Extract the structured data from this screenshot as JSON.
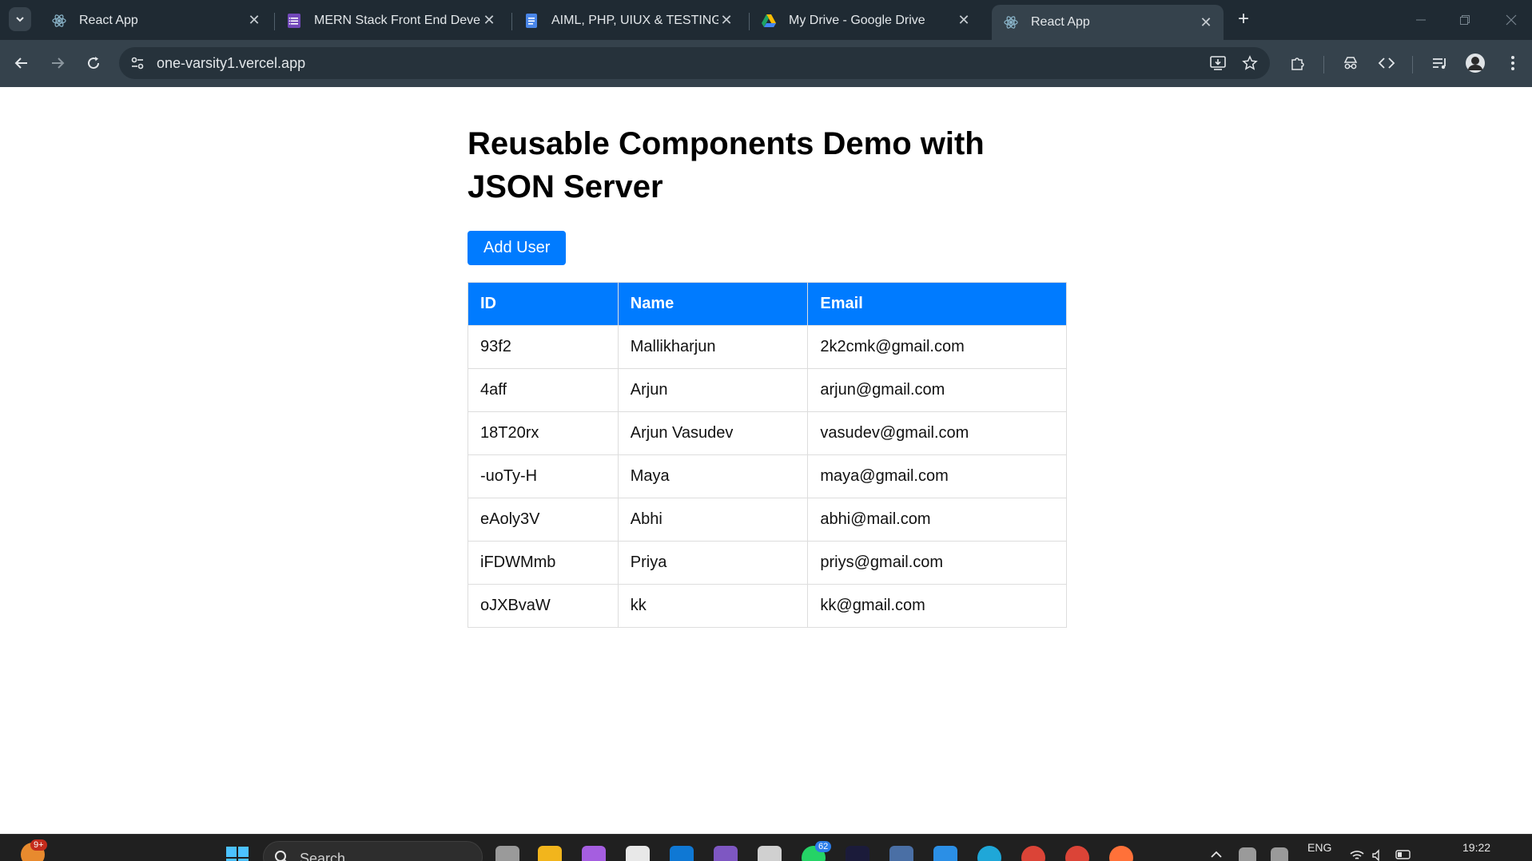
{
  "browser": {
    "tabs": [
      {
        "title": "React App",
        "favicon": "react-icon",
        "active": false
      },
      {
        "title": "MERN Stack Front End Develop",
        "favicon": "forms-icon",
        "active": false
      },
      {
        "title": "AIML, PHP, UIUX & TESTING_Int",
        "favicon": "docs-icon",
        "active": false
      },
      {
        "title": "My Drive - Google Drive",
        "favicon": "drive-icon",
        "active": false
      },
      {
        "title": "React App",
        "favicon": "react-icon",
        "active": true
      }
    ],
    "new_tab_label": "+",
    "address_bar": {
      "url": "one-varsity1.vercel.app"
    },
    "colors": {
      "tabstrip": "#1f2a33",
      "toolbar": "#35424c",
      "omnibox": "#26323b"
    }
  },
  "page": {
    "title": "Reusable Components Demo with JSON Server",
    "add_button_label": "Add User",
    "accent": "#007bff",
    "table": {
      "headers": [
        "ID",
        "Name",
        "Email"
      ],
      "rows": [
        [
          "93f2",
          "Mallikharjun",
          "2k2cmk@gmail.com"
        ],
        [
          "4aff",
          "Arjun",
          "arjun@gmail.com"
        ],
        [
          "18T20rx",
          "Arjun Vasudev",
          "vasudev@gmail.com"
        ],
        [
          "-uoTy-H",
          "Maya",
          "maya@gmail.com"
        ],
        [
          "eAoly3V",
          "Abhi",
          "abhi@mail.com"
        ],
        [
          "iFDWMmb",
          "Priya",
          "priys@gmail.com"
        ],
        [
          "oJXBvaW",
          "kk",
          "kk@gmail.com"
        ]
      ]
    }
  },
  "taskbar": {
    "search_placeholder": "Search",
    "weather_badge": "9+",
    "whatsapp_badge": "62",
    "language": "ENG",
    "time": "19:22"
  }
}
